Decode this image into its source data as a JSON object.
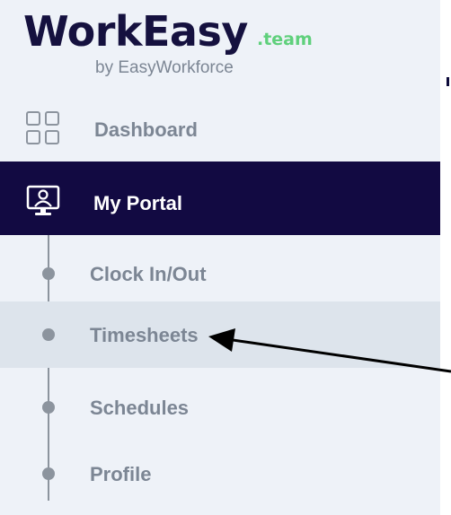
{
  "brand": {
    "logo_main": "WorkEasy",
    "logo_suffix": ".team",
    "tagline": "by EasyWorkforce",
    "colors": {
      "navy": "#120a42",
      "green": "#5fd07c",
      "muted": "#7c8694",
      "sidebar_bg": "#eef2f8",
      "active_bg": "#dde4ec"
    }
  },
  "nav": {
    "dashboard": {
      "label": "Dashboard",
      "icon": "grid-icon"
    },
    "portal": {
      "label": "My Portal",
      "icon": "monitor-user-icon",
      "selected": true
    }
  },
  "portal_items": [
    {
      "label": "Clock In/Out"
    },
    {
      "label": "Timesheets",
      "highlighted": true
    },
    {
      "label": "Schedules"
    },
    {
      "label": "Profile"
    }
  ],
  "annotation": {
    "icon": "arrow-pointer",
    "target": "Timesheets"
  }
}
